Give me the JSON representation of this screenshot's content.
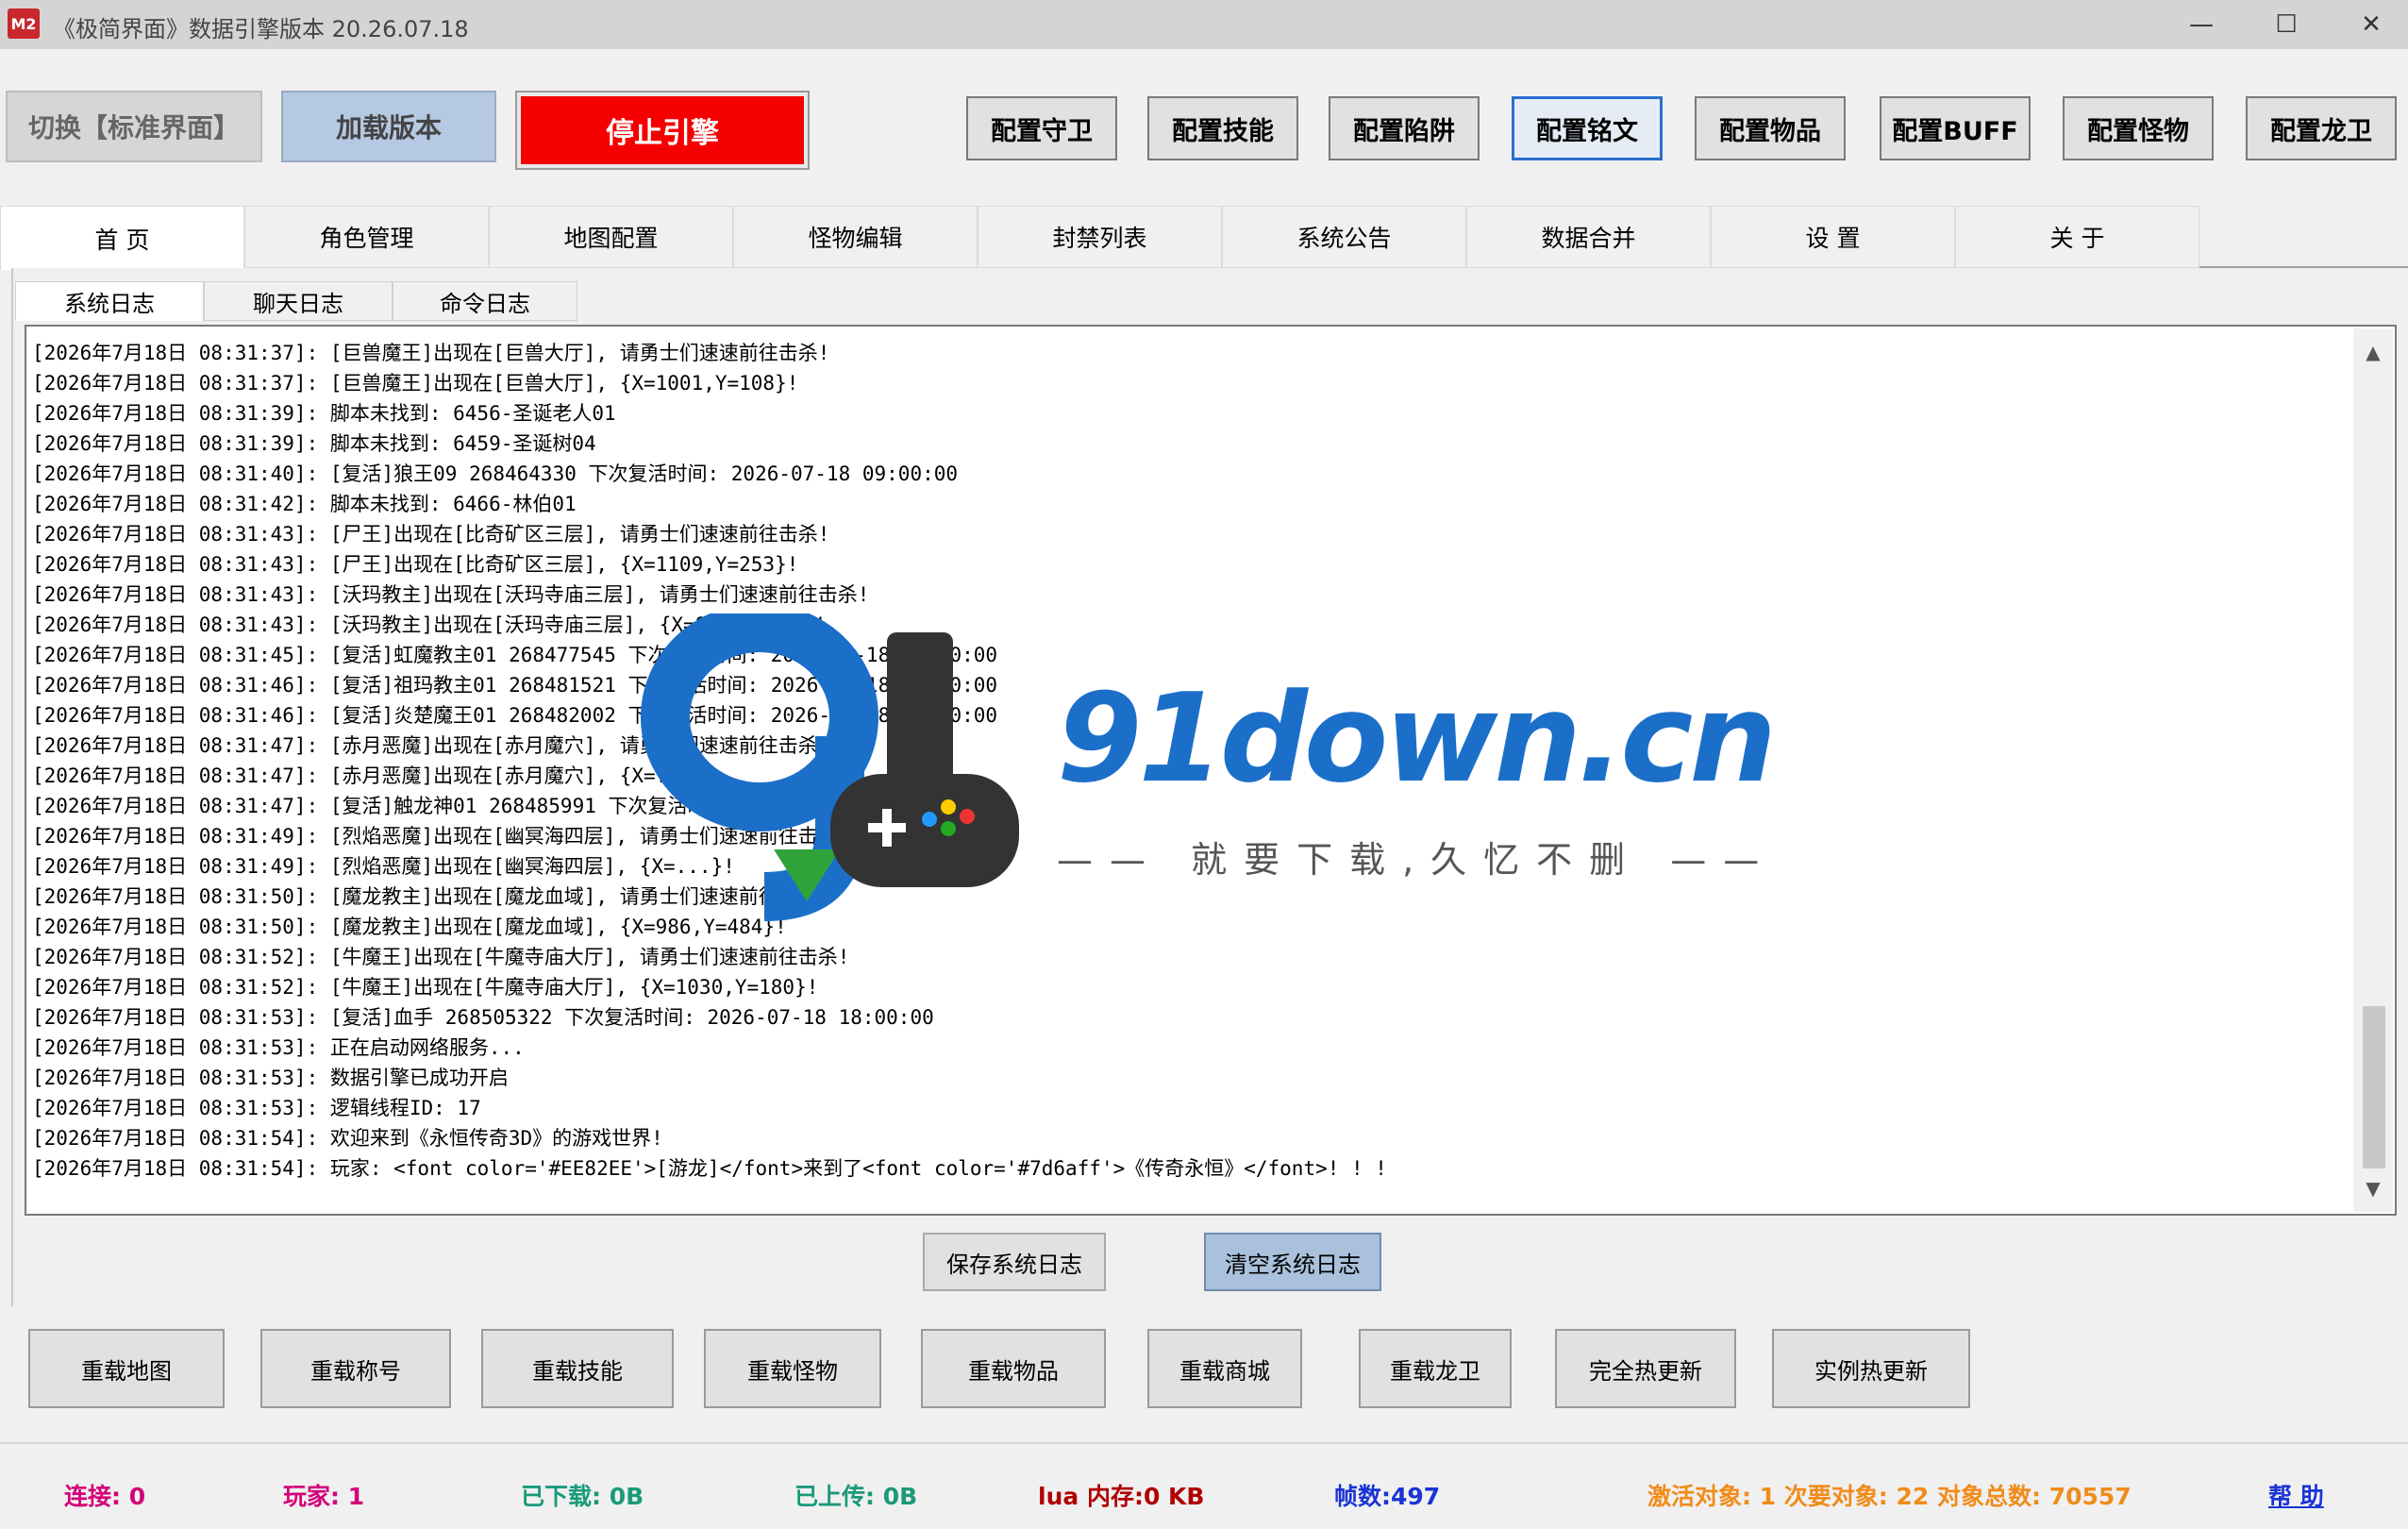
{
  "window": {
    "icon_text": "M2",
    "title": "《极简界面》数据引擎版本 20.26.07.18",
    "controls": {
      "minimize": "—",
      "maximize": "☐",
      "close": "✕"
    }
  },
  "toolbar": {
    "switch_label": "切换【标准界面】",
    "load_label": "加载版本",
    "stop_label": "停止引擎",
    "config_buttons": [
      "配置守卫",
      "配置技能",
      "配置陷阱",
      "配置铭文",
      "配置物品",
      "配置BUFF",
      "配置怪物",
      "配置龙卫"
    ],
    "active_config": "配置铭文"
  },
  "main_tabs": [
    "首 页",
    "角色管理",
    "地图配置",
    "怪物编辑",
    "封禁列表",
    "系统公告",
    "数据合并",
    "设 置",
    "关 于"
  ],
  "active_main_tab": "首 页",
  "sub_tabs": [
    "系统日志",
    "聊天日志",
    "命令日志"
  ],
  "active_sub_tab": "系统日志",
  "log_lines": [
    "[2026年7月18日 08:31:37]: [巨兽魔王]出现在[巨兽大厅], 请勇士们速速前往击杀!",
    "[2026年7月18日 08:31:37]: [巨兽魔王]出现在[巨兽大厅], {X=1001,Y=108}!",
    "[2026年7月18日 08:31:39]: 脚本未找到: 6456-圣诞老人01",
    "[2026年7月18日 08:31:39]: 脚本未找到: 6459-圣诞树04",
    "[2026年7月18日 08:31:40]: [复活]狼王09 268464330 下次复活时间: 2026-07-18 09:00:00",
    "[2026年7月18日 08:31:42]: 脚本未找到: 6466-林伯01",
    "[2026年7月18日 08:31:43]: [尸王]出现在[比奇矿区三层], 请勇士们速速前往击杀!",
    "[2026年7月18日 08:31:43]: [尸王]出现在[比奇矿区三层], {X=1109,Y=253}!",
    "[2026年7月18日 08:31:43]: [沃玛教主]出现在[沃玛寺庙三层], 请勇士们速速前往击杀!",
    "[2026年7月18日 08:31:43]: [沃玛教主]出现在[沃玛寺庙三层], {X=806,Y=293}!",
    "[2026年7月18日 08:31:45]: [复活]虹魔教主01 268477545 下次复活时间: 2026-07-18 15:00:00",
    "[2026年7月18日 08:31:46]: [复活]祖玛教主01 268481521 下次复活时间: 2026-07-18 15:00:00",
    "[2026年7月18日 08:31:46]: [复活]炎楚魔王01 268482002 下次复活时间: 2026-07-18 15:00:00",
    "[2026年7月18日 08:31:47]: [赤月恶魔]出现在[赤月魔穴], 请勇士们速速前往击杀!",
    "[2026年7月18日 08:31:47]: [赤月恶魔]出现在[赤月魔穴], {X=...}!",
    "[2026年7月18日 08:31:47]: [复活]触龙神01 268485991 下次复活时间: 2026-07-18 15:00:00",
    "[2026年7月18日 08:31:49]: [烈焰恶魔]出现在[幽冥海四层], 请勇士们速速前往击杀!",
    "[2026年7月18日 08:31:49]: [烈焰恶魔]出现在[幽冥海四层], {X=...}!",
    "[2026年7月18日 08:31:50]: [魔龙教主]出现在[魔龙血域], 请勇士们速速前往击杀!",
    "[2026年7月18日 08:31:50]: [魔龙教主]出现在[魔龙血域], {X=986,Y=484}!",
    "[2026年7月18日 08:31:52]: [牛魔王]出现在[牛魔寺庙大厅], 请勇士们速速前往击杀!",
    "[2026年7月18日 08:31:52]: [牛魔王]出现在[牛魔寺庙大厅], {X=1030,Y=180}!",
    "[2026年7月18日 08:31:53]: [复活]血手 268505322 下次复活时间: 2026-07-18 18:00:00",
    "[2026年7月18日 08:31:53]: 正在启动网络服务...",
    "[2026年7月18日 08:31:53]: 数据引擎已成功开启",
    "[2026年7月18日 08:31:53]: 逻辑线程ID: 17",
    "[2026年7月18日 08:31:54]: 欢迎来到《永恒传奇3D》的游戏世界!",
    "[2026年7月18日 08:31:54]: 玩家: <font color='#EE82EE'>[游龙]</font>来到了<font color='#7d6aff'>《传奇永恒》</font>! ! !"
  ],
  "log_actions": {
    "save": "保存系统日志",
    "clear": "清空系统日志"
  },
  "reload_buttons": [
    "重载地图",
    "重载称号",
    "重载技能",
    "重载怪物",
    "重载物品",
    "重载商城",
    "重载龙卫",
    "完全热更新",
    "实例热更新"
  ],
  "status": {
    "connections": {
      "text": "连接: 0",
      "color": "#d4007a"
    },
    "players": {
      "text": "玩家: 1",
      "color": "#d4007a"
    },
    "downloaded": {
      "text": "已下载: 0B",
      "color": "#1a9a7a"
    },
    "uploaded": {
      "text": "已上传: 0B",
      "color": "#1a9a7a"
    },
    "lua_memory": {
      "text": "lua 内存:0 KB",
      "color": "#b00000"
    },
    "fps": {
      "text": "帧数:497",
      "color": "#1a33d6"
    },
    "objects": {
      "text": "激活对象: 1  次要对象: 22  对象总数: 70557",
      "color": "#f08c1a"
    },
    "help": {
      "text": "帮 助",
      "color": "#1a33d6"
    }
  },
  "watermark": {
    "brand": "91down.cn",
    "slogan": "—— 就要下载,久忆不删 ——",
    "logo_icon": "91-gamepad-logo"
  }
}
